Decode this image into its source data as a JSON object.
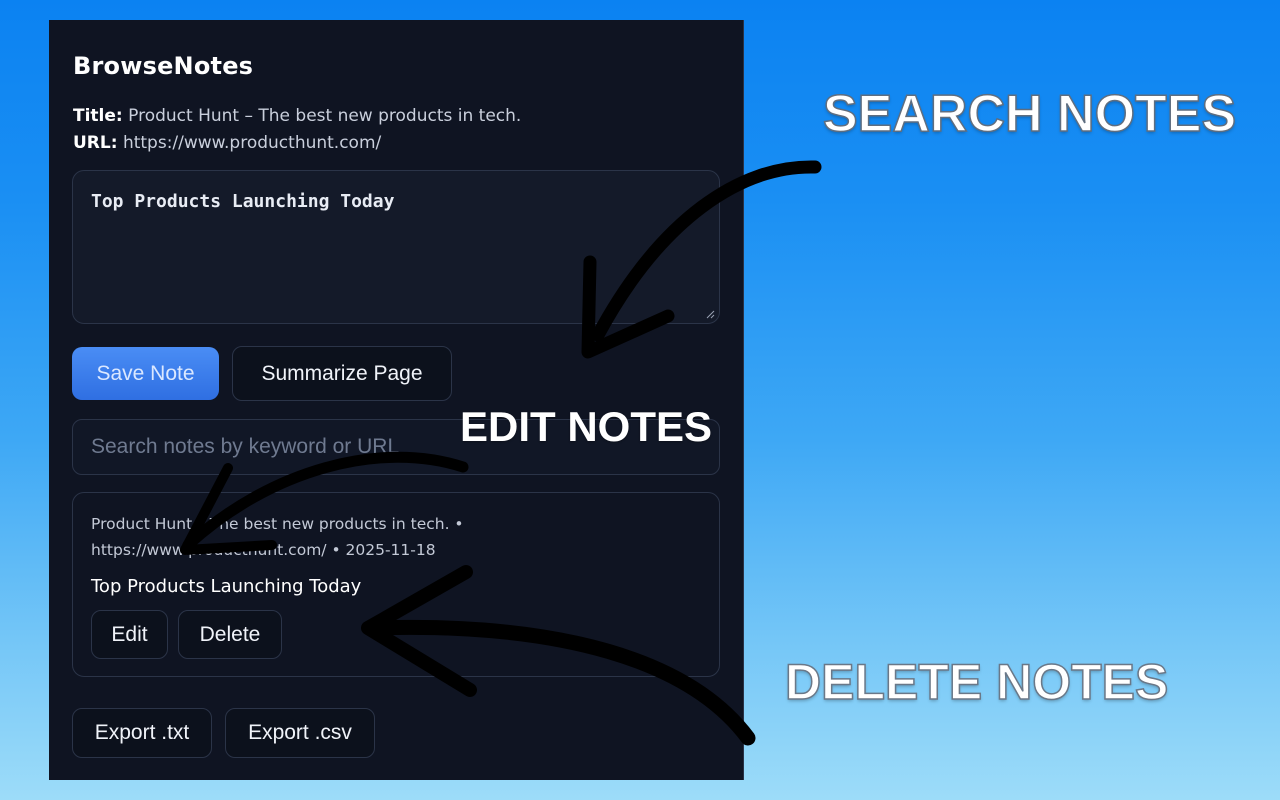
{
  "app": {
    "brand": "BrowseNotes"
  },
  "page_info": {
    "title_label": "Title:",
    "title_value": "Product Hunt – The best new products in tech.",
    "url_label": "URL:",
    "url_value": "https://www.producthunt.com/"
  },
  "editor": {
    "value": "Top Products Launching Today"
  },
  "actions": {
    "save_label": "Save Note",
    "summarize_label": "Summarize Page"
  },
  "search": {
    "placeholder": "Search notes by keyword or URL"
  },
  "notes": [
    {
      "meta_line1": "Product Hunt – The best new products in tech. •",
      "meta_line2": "https://www.producthunt.com/ • 2025-11-18",
      "content": "Top Products Launching Today",
      "edit_label": "Edit",
      "delete_label": "Delete"
    }
  ],
  "export": {
    "txt_label": "Export .txt",
    "csv_label": "Export .csv"
  },
  "callouts": {
    "search": "SEARCH NOTES",
    "edit": "EDIT NOTES",
    "delete": "DELETE NOTES"
  },
  "colors": {
    "panel_bg": "#0f1422",
    "primary_button": "#3a7ff0",
    "background_top": "#0b82f2",
    "background_bottom": "#9ddcf9"
  }
}
